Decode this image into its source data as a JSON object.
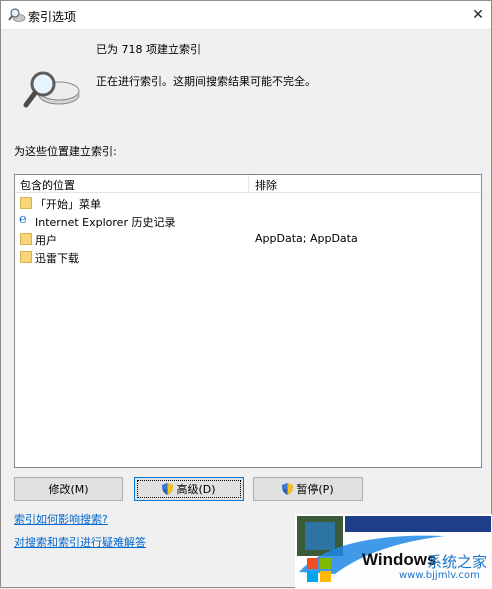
{
  "window": {
    "title": "索引选项"
  },
  "summary": {
    "count_text": "已为 718 项建立索引",
    "status_text": "正在进行索引。这期间搜索结果可能不完全。"
  },
  "locations": {
    "section_label": "为这些位置建立索引:",
    "columns": {
      "included": "包含的位置",
      "excluded": "排除"
    },
    "rows": [
      {
        "name": "「开始」菜单",
        "exclude": "",
        "icon": "folder-icon"
      },
      {
        "name": "Internet Explorer 历史记录",
        "exclude": "",
        "icon": "internet-explorer-icon"
      },
      {
        "name": "用户",
        "exclude": "AppData; AppData",
        "icon": "folder-icon"
      },
      {
        "name": "迅雷下载",
        "exclude": "",
        "icon": "folder-icon"
      }
    ]
  },
  "buttons": {
    "modify": "修改(M)",
    "advanced": "高级(D)",
    "pause": "暂停(P)"
  },
  "links": {
    "how_affects": "索引如何影响搜索?",
    "troubleshoot": "对搜索和索引进行疑难解答"
  },
  "watermark": {
    "brand": "Windows",
    "cn": "系统之家",
    "url": "www.bjjmlv.com"
  },
  "colors": {
    "link": "#0066cc",
    "folder": "#f7d67a",
    "focus": "#0078d7"
  }
}
